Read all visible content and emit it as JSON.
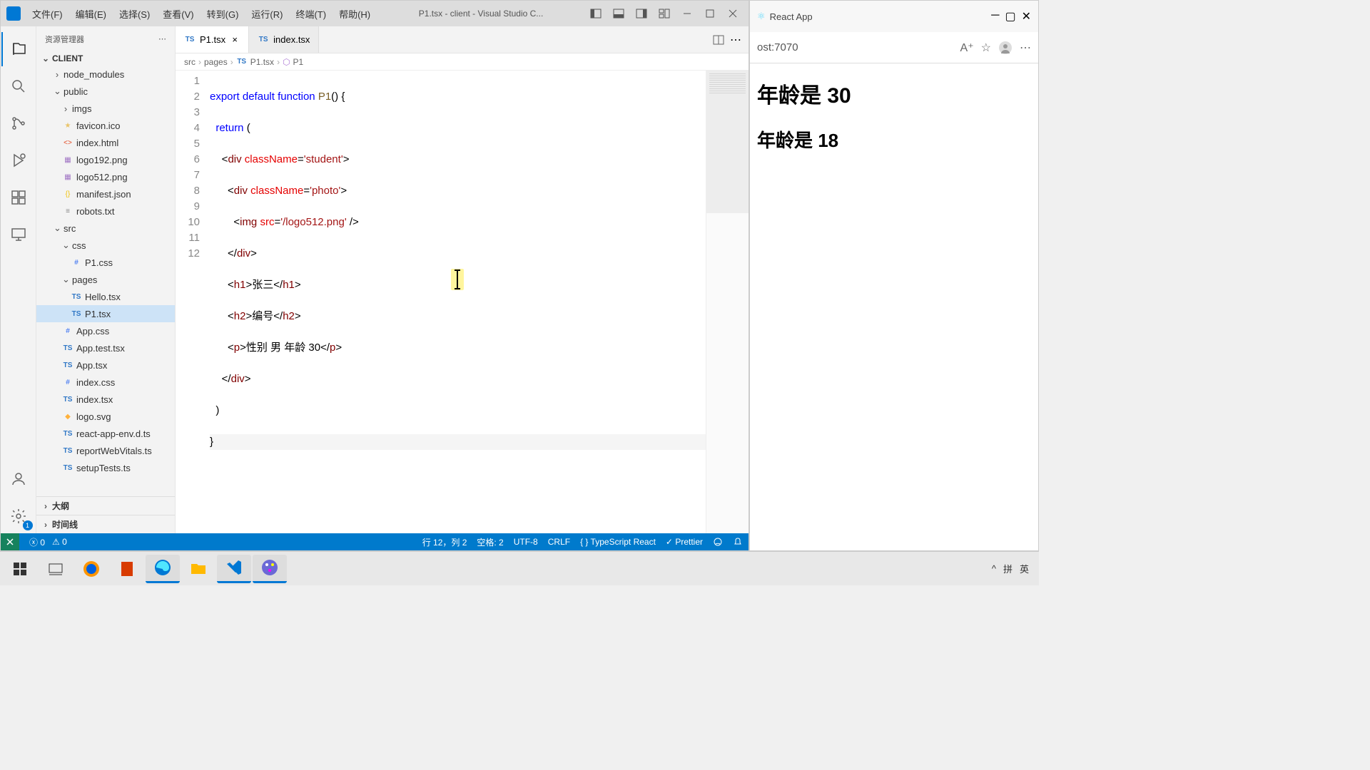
{
  "vscode": {
    "menu": [
      "文件(F)",
      "编辑(E)",
      "选择(S)",
      "查看(V)",
      "转到(G)",
      "运行(R)",
      "终端(T)",
      "帮助(H)"
    ],
    "title": "P1.tsx - client - Visual Studio C...",
    "explorer": {
      "header": "资源管理器",
      "root": "CLIENT",
      "tree": [
        {
          "name": "node_modules",
          "type": "folder",
          "depth": 1,
          "expanded": false
        },
        {
          "name": "public",
          "type": "folder",
          "depth": 1,
          "expanded": true
        },
        {
          "name": "imgs",
          "type": "folder",
          "depth": 2,
          "expanded": false
        },
        {
          "name": "favicon.ico",
          "type": "ico",
          "depth": 2
        },
        {
          "name": "index.html",
          "type": "html",
          "depth": 2
        },
        {
          "name": "logo192.png",
          "type": "img",
          "depth": 2
        },
        {
          "name": "logo512.png",
          "type": "img",
          "depth": 2
        },
        {
          "name": "manifest.json",
          "type": "json",
          "depth": 2
        },
        {
          "name": "robots.txt",
          "type": "txt",
          "depth": 2
        },
        {
          "name": "src",
          "type": "folder",
          "depth": 1,
          "expanded": true
        },
        {
          "name": "css",
          "type": "folder",
          "depth": 2,
          "expanded": true
        },
        {
          "name": "P1.css",
          "type": "css",
          "depth": 3
        },
        {
          "name": "pages",
          "type": "folder",
          "depth": 2,
          "expanded": true
        },
        {
          "name": "Hello.tsx",
          "type": "ts",
          "depth": 3
        },
        {
          "name": "P1.tsx",
          "type": "ts",
          "depth": 3,
          "active": true
        },
        {
          "name": "App.css",
          "type": "css",
          "depth": 2
        },
        {
          "name": "App.test.tsx",
          "type": "ts",
          "depth": 2
        },
        {
          "name": "App.tsx",
          "type": "ts",
          "depth": 2
        },
        {
          "name": "index.css",
          "type": "css",
          "depth": 2
        },
        {
          "name": "index.tsx",
          "type": "ts",
          "depth": 2
        },
        {
          "name": "logo.svg",
          "type": "svg",
          "depth": 2
        },
        {
          "name": "react-app-env.d.ts",
          "type": "ts",
          "depth": 2
        },
        {
          "name": "reportWebVitals.ts",
          "type": "ts",
          "depth": 2
        },
        {
          "name": "setupTests.ts",
          "type": "ts",
          "depth": 2
        }
      ],
      "outline": "大纲",
      "timeline": "时间线"
    },
    "tabs": [
      {
        "name": "P1.tsx",
        "icon": "ts",
        "active": true
      },
      {
        "name": "index.tsx",
        "icon": "ts",
        "active": false
      }
    ],
    "breadcrumb": [
      "src",
      "pages",
      "P1.tsx",
      "P1"
    ],
    "code_lines": 12,
    "statusbar": {
      "errors": "0",
      "warnings": "0",
      "cursor": "行 12，列 2",
      "spaces": "空格: 2",
      "encoding": "UTF-8",
      "eol": "CRLF",
      "lang": "TypeScript React",
      "prettier": "Prettier"
    }
  },
  "browser": {
    "tab_title": "React App",
    "url_suffix": "ost:7070",
    "content_h1": "年龄是 30",
    "content_h2": "年龄是 18"
  },
  "taskbar": {
    "ime": "英",
    "ime2": "拼"
  }
}
